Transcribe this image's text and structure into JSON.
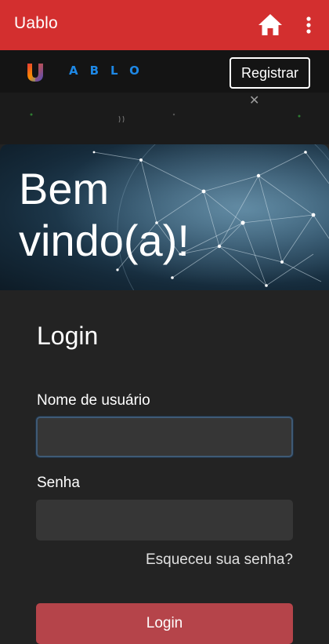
{
  "app_bar": {
    "title": "Uablo",
    "home_icon": "home-icon",
    "menu_icon": "more-vert-icon",
    "background": "#d32f2f"
  },
  "site_header": {
    "logo_text": "ABLO",
    "register_label": "Registrar"
  },
  "banner": {
    "title": "Bem\nvindo(a)!"
  },
  "login": {
    "heading": "Login",
    "username_label": "Nome de usuário",
    "username_value": "",
    "password_label": "Senha",
    "password_value": "",
    "forgot_label": "Esqueceu sua senha?",
    "submit_label": "Login",
    "submit_color": "#b5444a"
  }
}
